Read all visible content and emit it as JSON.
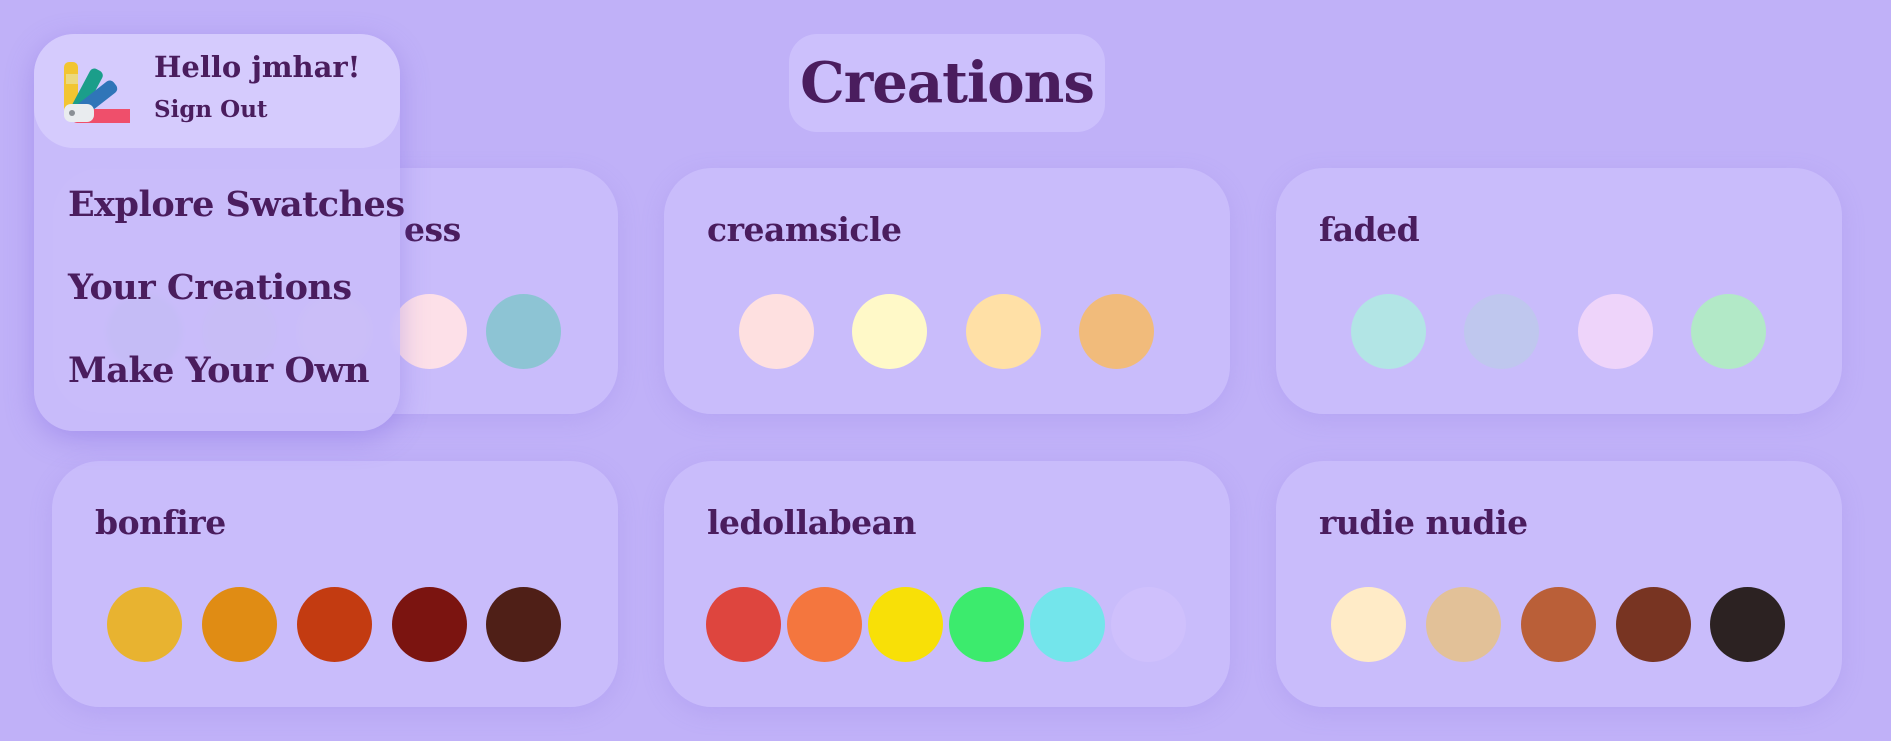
{
  "title": "Creations",
  "user": {
    "greeting": "Hello jmhar!",
    "sign_out_label": "Sign Out"
  },
  "menu": {
    "items": [
      {
        "label": "Explore Swatches"
      },
      {
        "label": "Your Creations"
      },
      {
        "label": "Make Your Own"
      }
    ]
  },
  "palettes": [
    {
      "name": "ess",
      "colors": [
        "#93bfca",
        "#bec9cf",
        "#dcd5df",
        "#fde0e8",
        "#8dc4d4"
      ]
    },
    {
      "name": "creamsicle",
      "colors": [
        "#fee0e0",
        "#fff9c8",
        "#ffe0a6",
        "#f1bb7b"
      ]
    },
    {
      "name": "faded",
      "colors": [
        "#b2e5e5",
        "#bfc7ee",
        "#eed4fa",
        "#b2e9c7"
      ]
    },
    {
      "name": "bonfire",
      "colors": [
        "#e8b330",
        "#e08c14",
        "#c33b11",
        "#7b1410",
        "#4f1f17"
      ]
    },
    {
      "name": "ledollabean",
      "colors": [
        "#de453e",
        "#f4763e",
        "#f8e007",
        "#3ceb6d",
        "#73e5eb",
        "#cfc0fc"
      ]
    },
    {
      "name": "rudie nudie",
      "colors": [
        "#ffebc7",
        "#e2c198",
        "#ba5f38",
        "#783422",
        "#2c2222"
      ]
    }
  ]
}
